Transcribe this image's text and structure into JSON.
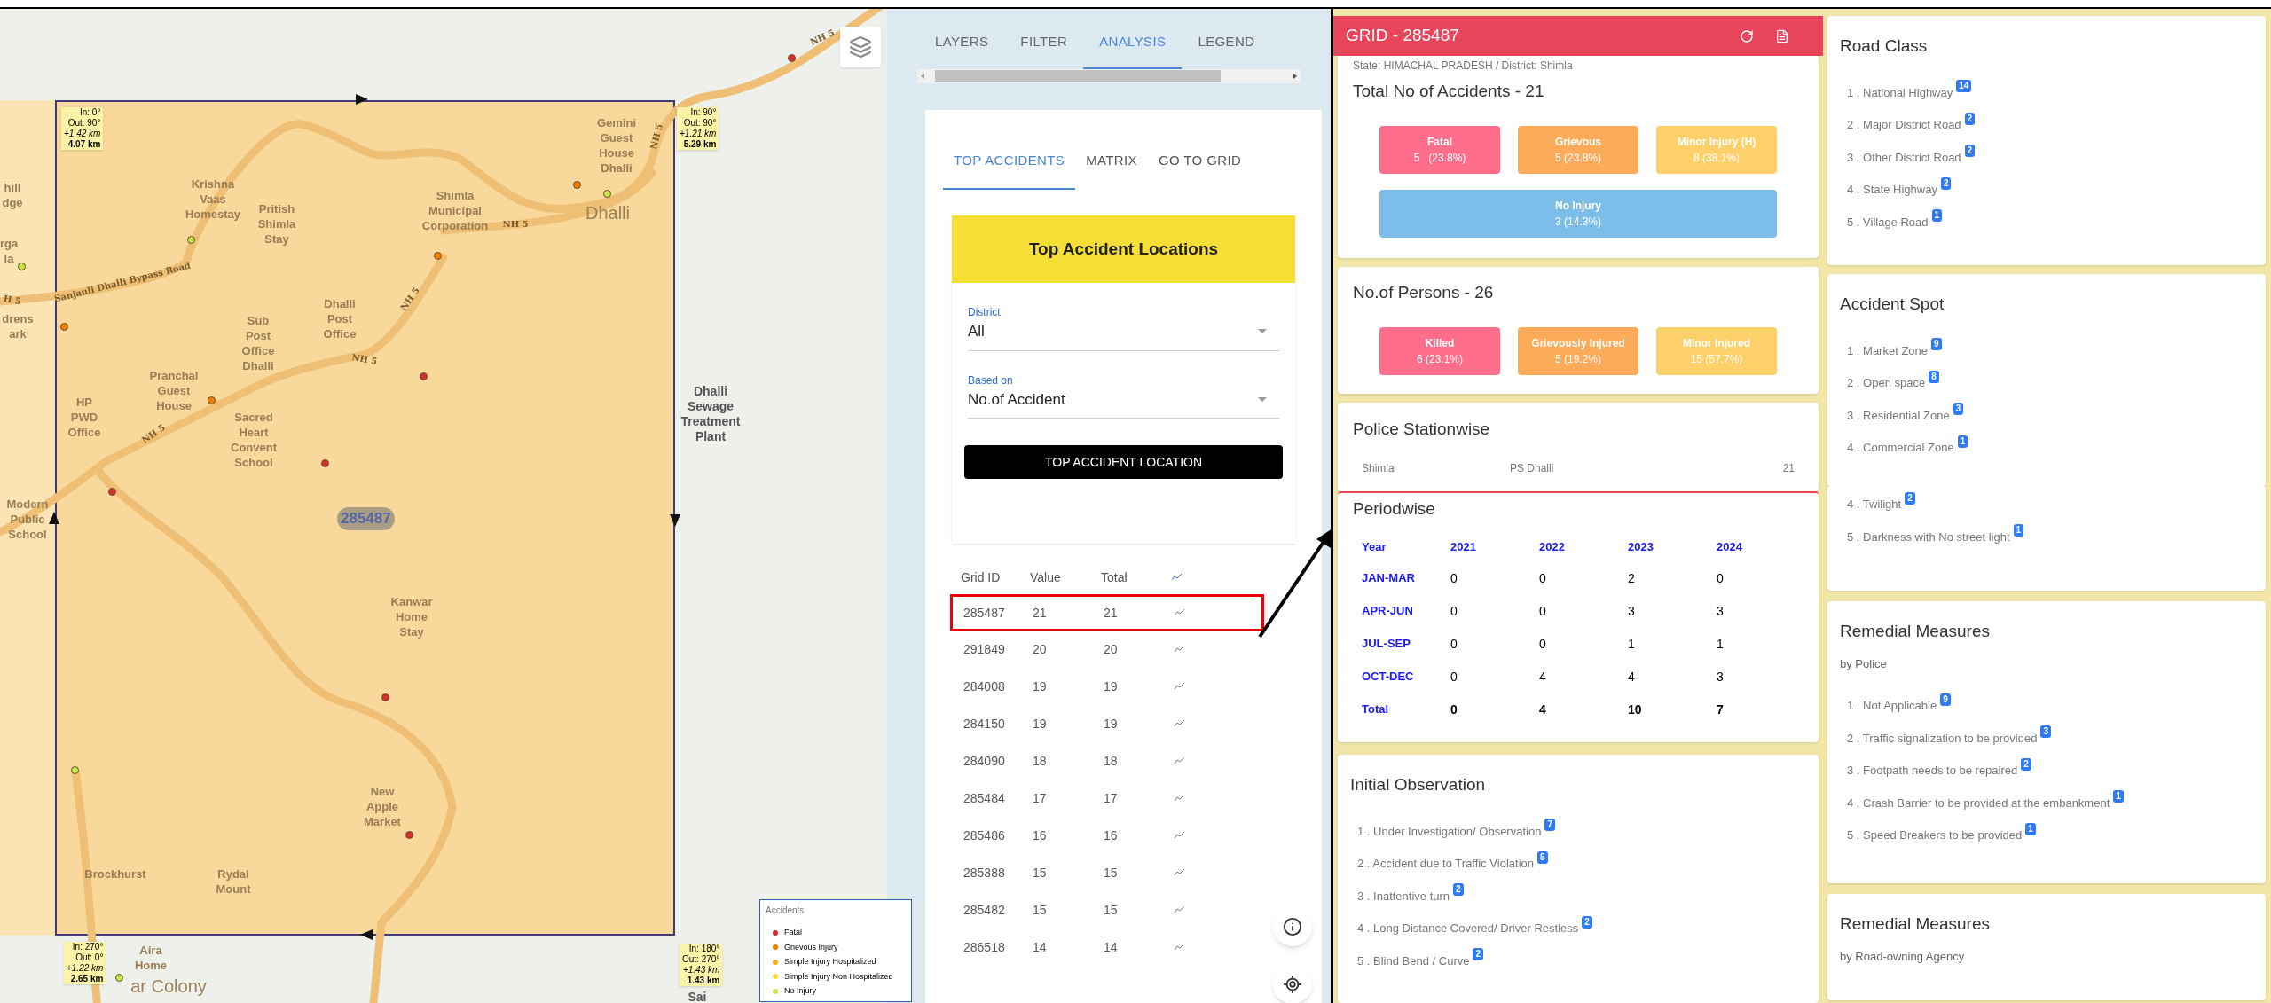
{
  "map": {
    "grid_label": "285487",
    "corner_labels": [
      {
        "lines": [
          "In: 0°",
          "Out: 90°",
          "+1.42 km",
          "4.07 km"
        ]
      },
      {
        "lines": [
          "In: 90°",
          "Out: 90°",
          "+1.21 km",
          "5.29 km"
        ]
      },
      {
        "lines": [
          "In: 270°",
          "Out: 0°",
          "+1.22 km",
          "2.65 km"
        ]
      },
      {
        "lines": [
          "In: 180°",
          "Out: 270°",
          "+1.43 km",
          "1.43 km"
        ]
      }
    ],
    "places": [
      {
        "kind": "place",
        "lines": [
          "Krishna",
          "Vaas",
          "Homestay"
        ]
      },
      {
        "kind": "place",
        "lines": [
          "Pritish",
          "Shimla",
          "Stay"
        ]
      },
      {
        "kind": "place",
        "lines": [
          "Shimla",
          "Municipal",
          "Corporation"
        ]
      },
      {
        "kind": "place",
        "lines": [
          "Gemini",
          "Guest",
          "House",
          "Dhalli"
        ]
      },
      {
        "kind": "area",
        "lines": [
          "Dhalli"
        ]
      },
      {
        "kind": "place",
        "lines": [
          "Dhalli",
          "Post",
          "Office"
        ]
      },
      {
        "kind": "place",
        "lines": [
          "Sub",
          "Post",
          "Office",
          "Dhalli"
        ]
      },
      {
        "kind": "place",
        "lines": [
          "Pranchal",
          "Guest",
          "House"
        ]
      },
      {
        "kind": "place",
        "lines": [
          "HP",
          "PWD",
          "Office"
        ]
      },
      {
        "kind": "place",
        "lines": [
          "Sacred",
          "Heart",
          "Convent",
          "School"
        ]
      },
      {
        "kind": "place",
        "lines": [
          "Modern",
          "Public",
          "School"
        ]
      },
      {
        "kind": "place",
        "lines": [
          "Kanwar",
          "Home",
          "Stay"
        ]
      },
      {
        "kind": "place",
        "lines": [
          "New",
          "Apple",
          "Market"
        ]
      },
      {
        "kind": "place",
        "lines": [
          "Brockhurst"
        ]
      },
      {
        "kind": "place",
        "lines": [
          "Rydal",
          "Mount"
        ]
      },
      {
        "kind": "place",
        "lines": [
          "Aira",
          "Home"
        ]
      },
      {
        "kind": "area",
        "lines": [
          "ar Colony"
        ]
      },
      {
        "kind": "outside",
        "lines": [
          "Dhalli",
          "Sewage",
          "Treatment",
          "Plant"
        ]
      },
      {
        "kind": "place",
        "lines": [
          "hill",
          "dge"
        ]
      },
      {
        "kind": "place",
        "lines": [
          "rga",
          "la"
        ]
      },
      {
        "kind": "place",
        "lines": [
          "drens",
          "ark"
        ]
      },
      {
        "kind": "outside",
        "lines": [
          "Sai"
        ]
      }
    ],
    "road_labels": [
      "NH 5",
      "NH 5",
      "NH 5",
      "NH 5",
      "NH 5",
      "NH 5",
      "H 5",
      "Sanjauli Dhalli Bypass Road"
    ],
    "legend": {
      "title": "Accidents",
      "items": [
        {
          "label": "Fatal",
          "color": "#d32f2f"
        },
        {
          "label": "Grievous Injury",
          "color": "#f57c00"
        },
        {
          "label": "Simple Injury Hospitalized",
          "color": "#f9a825"
        },
        {
          "label": "Simple Injury Non Hospitalized",
          "color": "#fdd835"
        },
        {
          "label": "No Injury",
          "color": "#c6e84a"
        }
      ]
    }
  },
  "panel": {
    "tabs": [
      {
        "label": "LAYERS",
        "selected": false
      },
      {
        "label": "FILTER",
        "selected": false
      },
      {
        "label": "ANALYSIS",
        "selected": true
      },
      {
        "label": "LEGEND",
        "selected": false
      }
    ],
    "subtabs": [
      {
        "label": "TOP ACCIDENTS",
        "selected": true
      },
      {
        "label": "MATRIX",
        "selected": false
      },
      {
        "label": "GO TO GRID",
        "selected": false
      }
    ],
    "card_title": "Top Accident Locations",
    "fields": [
      {
        "label": "District",
        "value": "All"
      },
      {
        "label": "Based on",
        "value": "No.of Accident"
      }
    ],
    "button": "TOP ACCIDENT LOCATION",
    "table": {
      "columns": [
        "Grid ID",
        "Value",
        "Total"
      ],
      "rows": [
        {
          "cells": [
            "285487",
            "21",
            "21"
          ],
          "selected": true
        },
        {
          "cells": [
            "291849",
            "20",
            "20"
          ],
          "selected": false
        },
        {
          "cells": [
            "284008",
            "19",
            "19"
          ],
          "selected": false
        },
        {
          "cells": [
            "284150",
            "19",
            "19"
          ],
          "selected": false
        },
        {
          "cells": [
            "284090",
            "18",
            "18"
          ],
          "selected": false
        },
        {
          "cells": [
            "285484",
            "17",
            "17"
          ],
          "selected": false
        },
        {
          "cells": [
            "285486",
            "16",
            "16"
          ],
          "selected": false
        },
        {
          "cells": [
            "285388",
            "15",
            "15"
          ],
          "selected": false
        },
        {
          "cells": [
            "285482",
            "15",
            "15"
          ],
          "selected": false
        },
        {
          "cells": [
            "286518",
            "14",
            "14"
          ],
          "selected": false
        }
      ]
    }
  },
  "grid": {
    "title": "GRID - 285487",
    "location": "State: HIMACHAL PRADESH / District: Shimla",
    "accidents": {
      "title": "Total No of Accidents - 21",
      "tiles": [
        {
          "label": "Fatal",
          "value": "5   (23.8%)",
          "color": "#fe6e8b"
        },
        {
          "label": "Grievous",
          "value": "5 (23.8%)",
          "color": "#fdab58"
        },
        {
          "label": "Minor Injury (H)",
          "value": "8 (38.1%)",
          "color": "#fdd06a"
        },
        {
          "label": "No Injury",
          "value": "3 (14.3%)",
          "color": "#7dbdea"
        }
      ]
    },
    "persons": {
      "title": "No.of Persons - 26",
      "tiles": [
        {
          "label": "Killed",
          "value": "6 (23.1%)",
          "color": "#fe6e8b"
        },
        {
          "label": "Grievously Injured",
          "value": "5 (19.2%)",
          "color": "#fdab58"
        },
        {
          "label": "Minor Injured",
          "value": "15 (57.7%)",
          "color": "#fdd06a"
        }
      ]
    },
    "police": {
      "title": "Police Stationwise",
      "rows": [
        [
          "Shimla",
          "PS Dhalli",
          "21"
        ]
      ]
    },
    "periodwise": {
      "title": "Periodwise",
      "columns": [
        "Year",
        "2021",
        "2022",
        "2023",
        "2024"
      ],
      "rows": [
        {
          "cells": [
            "JAN-MAR",
            "0",
            "0",
            "2",
            "0"
          ],
          "total": false
        },
        {
          "cells": [
            "APR-JUN",
            "0",
            "0",
            "3",
            "3"
          ],
          "total": false
        },
        {
          "cells": [
            "JUL-SEP",
            "0",
            "0",
            "1",
            "1"
          ],
          "total": false
        },
        {
          "cells": [
            "OCT-DEC",
            "0",
            "4",
            "4",
            "3"
          ],
          "total": false
        },
        {
          "cells": [
            "Total",
            "0",
            "4",
            "10",
            "7"
          ],
          "total": true
        }
      ]
    },
    "observation": {
      "title": "Initial Observation",
      "items": [
        {
          "label": "1 . Under Investigation/ Observation",
          "count": "7"
        },
        {
          "label": "2 . Accident due to Traffic Violation",
          "count": "5"
        },
        {
          "label": "3 . Inattentive turn",
          "count": "2"
        },
        {
          "label": "4 . Long Distance Covered/ Driver Restless",
          "count": "2"
        },
        {
          "label": "5 . Blind Bend / Curve",
          "count": "2"
        }
      ]
    },
    "side_lists": [
      {
        "title": "Road Class",
        "items": [
          {
            "label": "1 . National Highway",
            "count": "14"
          },
          {
            "label": "2 . Major District Road",
            "count": "2"
          },
          {
            "label": "3 . Other District Road",
            "count": "2"
          },
          {
            "label": "4 . State Highway",
            "count": "2"
          },
          {
            "label": "5 . Village Road",
            "count": "1"
          }
        ]
      },
      {
        "title": "Accident Spot",
        "items": [
          {
            "label": "1 . Market Zone",
            "count": "9"
          },
          {
            "label": "2 . Open space",
            "count": "8"
          },
          {
            "label": "3 . Residential Zone",
            "count": "3"
          },
          {
            "label": "4 . Commercial Zone",
            "count": "1"
          }
        ]
      },
      {
        "items": [
          {
            "label": "4 . Twilight",
            "count": "2"
          },
          {
            "label": "5 . Darkness with No street light",
            "count": "1"
          }
        ]
      },
      {
        "title": "Remedial Measures",
        "subtitle": "by Police",
        "items": [
          {
            "label": "1 . Not Applicable",
            "count": "9"
          },
          {
            "label": "2 . Traffic signalization to be provided",
            "count": "3"
          },
          {
            "label": "3 . Footpath needs to be repaired",
            "count": "2"
          },
          {
            "label": "4 . Crash Barrier to be provided at the embankment",
            "count": "1"
          },
          {
            "label": "5 . Speed Breakers to be provided",
            "count": "1"
          }
        ]
      },
      {
        "title": "Remedial Measures",
        "subtitle": "by Road-owning Agency"
      }
    ]
  }
}
